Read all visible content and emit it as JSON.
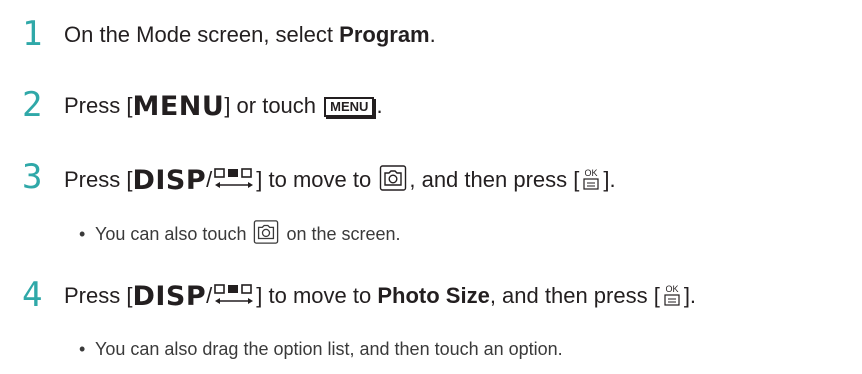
{
  "steps": [
    {
      "number": "1",
      "pre": "On the Mode screen, select ",
      "bold": "Program",
      "post": "."
    },
    {
      "number": "2",
      "pre": "Press [",
      "key": "MENU",
      "mid": "] or touch ",
      "button": "MENU",
      "post": "."
    },
    {
      "number": "3",
      "pre": "Press [",
      "key": "DISP",
      "slash": "/",
      "mid": "] to move to ",
      "mid2": ", and then press [",
      "post": "].",
      "note": "You can also touch ",
      "note_post": " on the screen."
    },
    {
      "number": "4",
      "pre": "Press [",
      "key": "DISP",
      "slash": "/",
      "mid": "] to move to ",
      "bold": "Photo Size",
      "mid2": ", and then press [",
      "post": "].",
      "note": "You can also drag the option list, and then touch an option."
    }
  ],
  "icons": {
    "navigate": "multi-selector-icon",
    "camera": "camera-settings-tab-icon",
    "ok": "ok-button-icon",
    "ok_text": "OK"
  },
  "accent_color": "#2fa8a8",
  "bullet": "•"
}
